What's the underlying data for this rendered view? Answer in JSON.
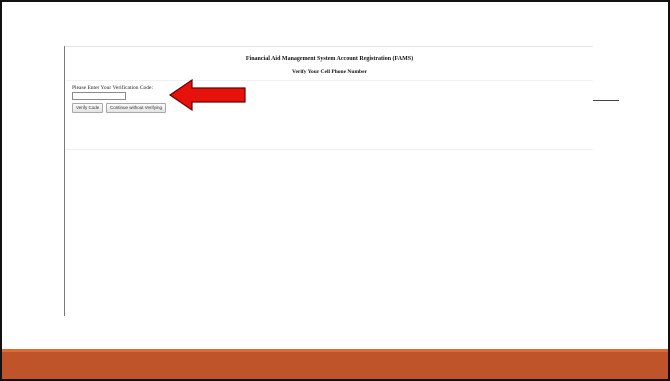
{
  "header": {
    "title": "Financial Aid Management System Account Registration (FAMS)",
    "subtitle": "Verify Your Cell Phone Number"
  },
  "form": {
    "code_label": "Please Enter Your Verification Code:",
    "code_value": "",
    "verify_button": "Verify Code",
    "continue_button": "Continue without Verifying"
  },
  "annotation": {
    "arrow_icon": "left-arrow-icon",
    "arrow_color": "#e8120c"
  },
  "theme": {
    "footer_color": "#bf5329",
    "footer_accent": "#e06a32"
  }
}
